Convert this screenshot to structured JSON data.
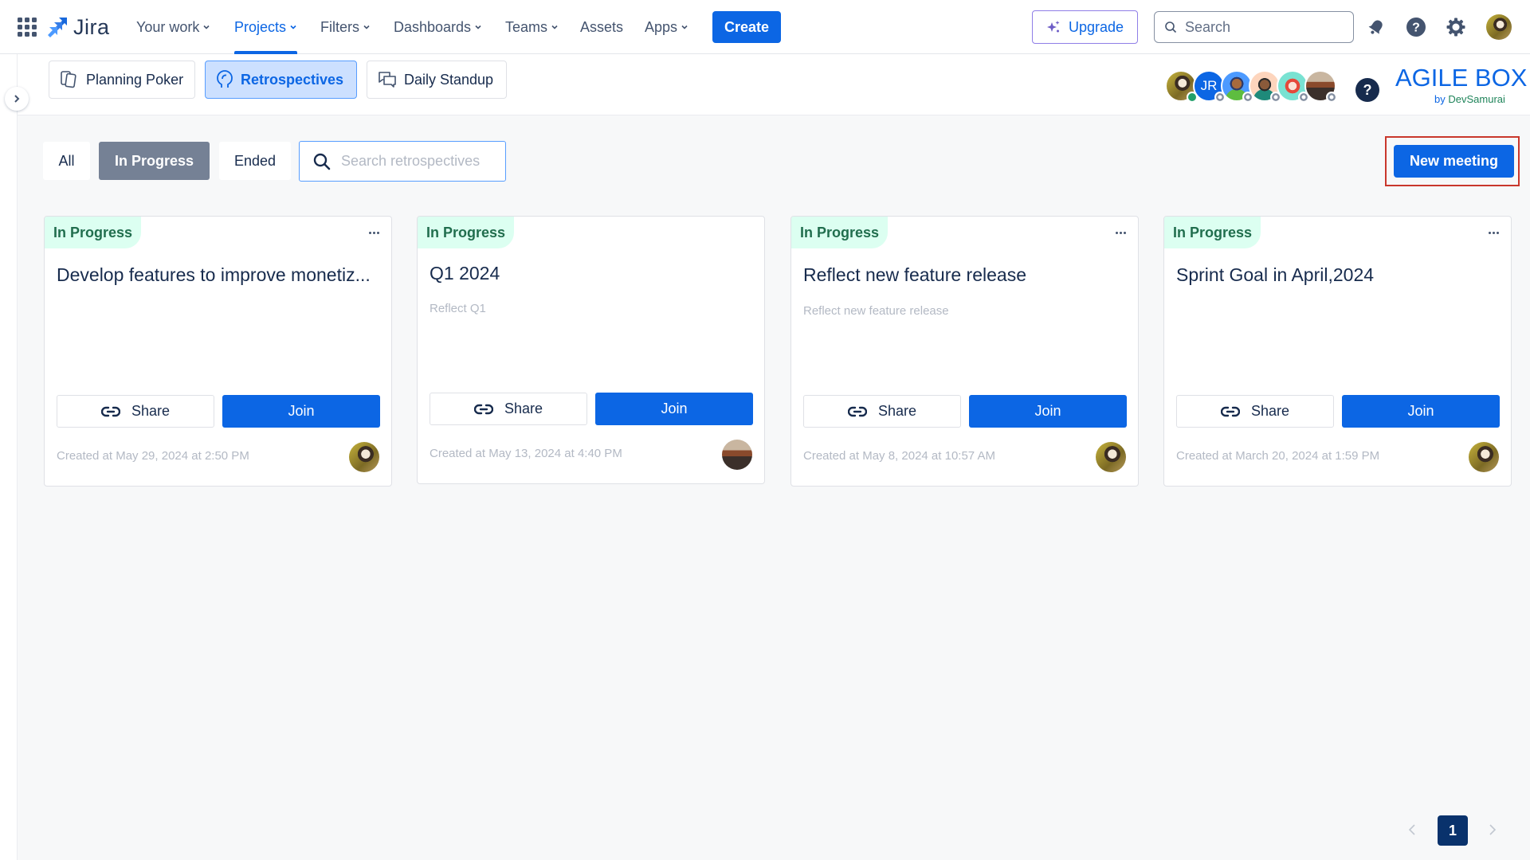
{
  "topnav": {
    "product": "Jira",
    "items": [
      {
        "label": "Your work",
        "dropdown": true,
        "active": false
      },
      {
        "label": "Projects",
        "dropdown": true,
        "active": true
      },
      {
        "label": "Filters",
        "dropdown": true,
        "active": false
      },
      {
        "label": "Dashboards",
        "dropdown": true,
        "active": false
      },
      {
        "label": "Teams",
        "dropdown": true,
        "active": false
      },
      {
        "label": "Assets",
        "dropdown": false,
        "active": false
      },
      {
        "label": "Apps",
        "dropdown": true,
        "active": false
      }
    ],
    "create_label": "Create",
    "upgrade_label": "Upgrade",
    "search_placeholder": "Search",
    "accent": "#0c66e4"
  },
  "subheader": {
    "tabs": [
      {
        "label": "Planning Poker",
        "icon": "cards-icon",
        "active": false
      },
      {
        "label": "Retrospectives",
        "icon": "retro-head-icon",
        "active": true
      },
      {
        "label": "Daily Standup",
        "icon": "chat-bubbles-icon",
        "active": false
      }
    ],
    "participants": [
      {
        "initials": "",
        "type": "photo",
        "status": "online"
      },
      {
        "initials": "JR",
        "type": "initials",
        "color": "#0c66e4",
        "status": "offline"
      },
      {
        "initials": "",
        "type": "cartoon-blue",
        "status": "offline"
      },
      {
        "initials": "",
        "type": "cartoon-peach",
        "status": "offline"
      },
      {
        "initials": "",
        "type": "cartoon-teal",
        "status": "offline"
      },
      {
        "initials": "",
        "type": "photo-building",
        "status": "offline"
      }
    ],
    "help_label": "?",
    "brand_title": "AGILE BOX",
    "brand_by": "by",
    "brand_company": "DevSamurai"
  },
  "filters": {
    "tabs": [
      {
        "label": "All",
        "active": false
      },
      {
        "label": "In Progress",
        "active": true
      },
      {
        "label": "Ended",
        "active": false
      }
    ],
    "search_placeholder": "Search retrospectives",
    "search_value": "",
    "new_meeting_label": "New meeting"
  },
  "cards": [
    {
      "status": "In Progress",
      "title": "Develop features to improve monetiz...",
      "description": "",
      "has_menu": true,
      "share_label": "Share",
      "join_label": "Join",
      "created": "Created at May 29, 2024 at 2:50 PM",
      "owner": "photo"
    },
    {
      "status": "In Progress",
      "title": "Q1 2024",
      "description": "Reflect Q1",
      "has_menu": false,
      "share_label": "Share",
      "join_label": "Join",
      "created": "Created at May 13, 2024 at 4:40 PM",
      "owner": "photo-building"
    },
    {
      "status": "In Progress",
      "title": "Reflect new feature release",
      "description": "Reflect new feature release",
      "has_menu": true,
      "share_label": "Share",
      "join_label": "Join",
      "created": "Created at May 8, 2024 at 10:57 AM",
      "owner": "photo"
    },
    {
      "status": "In Progress",
      "title": "Sprint Goal in April,2024",
      "description": "",
      "has_menu": true,
      "share_label": "Share",
      "join_label": "Join",
      "created": "Created at March 20, 2024 at 1:59 PM",
      "owner": "photo"
    }
  ],
  "pagination": {
    "current_page": "1",
    "prev_enabled": false,
    "next_enabled": false
  }
}
